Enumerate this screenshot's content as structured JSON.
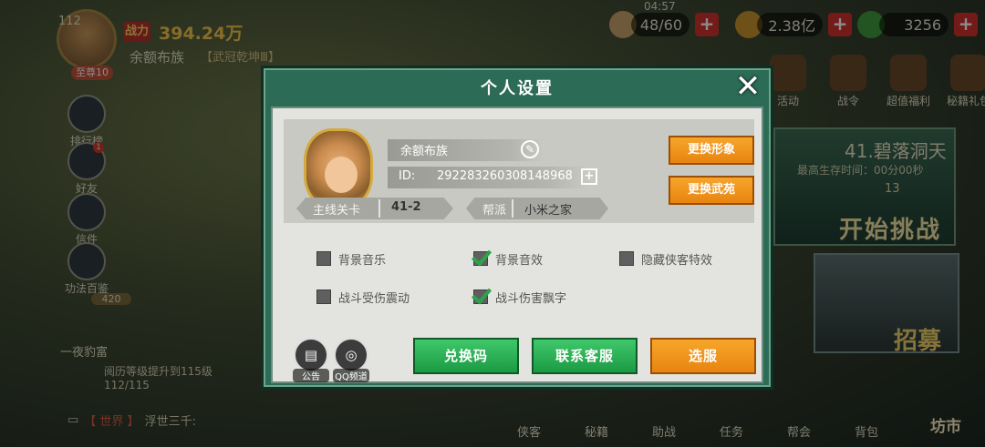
{
  "hud": {
    "player_level": "112",
    "power_badge": "战力",
    "power_value": "394.24万",
    "player_name": "余额布族",
    "player_title": "【武冠乾坤Ⅲ】",
    "rank_badge": "至尊10",
    "clock": "04:57",
    "stamina": "48/60",
    "coins": "2.38亿",
    "jade": "3256"
  },
  "side_menu": [
    {
      "label": "排行榜"
    },
    {
      "label": "好友",
      "badge": "1"
    },
    {
      "label": "信件"
    },
    {
      "label": "功法百鉴"
    }
  ],
  "rich_label": "一夜豹富",
  "rich_count": "420",
  "exp_text": "阅历等级提升到115级 112/115",
  "chat": {
    "channel": "【 世界 】",
    "text": "浮世三千:"
  },
  "top_icons": [
    "活动",
    "战令",
    "超值福利",
    "秘籍礼包"
  ],
  "stage_panel": {
    "title": "41.碧落洞天",
    "sub": "最高生存时间：00分00秒",
    "count": "13",
    "start": "开始挑战"
  },
  "recruit_label": "招募",
  "bottom_nav": [
    "侠客",
    "秘籍",
    "助战",
    "任务",
    "帮会",
    "背包"
  ],
  "market_label": "坊市",
  "modal": {
    "title": "个人设置",
    "close": "✕",
    "profile": {
      "name": "余额布族",
      "id_label": "ID:",
      "id_value": "292283260308148968",
      "stage_label": "主线关卡",
      "stage_value": "41-2",
      "guild_label": "帮派",
      "guild_value": "小米之家"
    },
    "buttons": {
      "change_look": "更换形象",
      "change_garden": "更换武苑",
      "redeem": "兑换码",
      "contact": "联系客服",
      "select_server": "选服"
    },
    "options": [
      {
        "label": "背景音乐",
        "checked": false
      },
      {
        "label": "背景音效",
        "checked": true
      },
      {
        "label": "隐藏侠客特效",
        "checked": false
      },
      {
        "label": "战斗受伤震动",
        "checked": false
      },
      {
        "label": "战斗伤害飘字",
        "checked": true
      }
    ],
    "icon_buttons": {
      "notice": "公告",
      "qq": "QQ频道"
    }
  },
  "colors": {
    "modal_bg": "#2c6b56",
    "panel_bg": "#e3e3df",
    "green_button": "#2bb456",
    "orange_button": "#f09a1f",
    "check_green": "#2ba34b"
  }
}
